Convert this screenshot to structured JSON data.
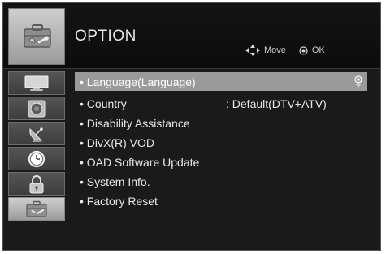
{
  "header": {
    "title": "OPTION",
    "icon": "toolbox-icon",
    "hints": {
      "move_label": "Move",
      "ok_label": "OK"
    }
  },
  "sidebar": {
    "items": [
      {
        "name": "picture",
        "icon": "monitor-icon",
        "active": false
      },
      {
        "name": "sound",
        "icon": "speaker-icon",
        "active": false
      },
      {
        "name": "setup",
        "icon": "satellite-dish-icon",
        "active": false
      },
      {
        "name": "time",
        "icon": "clock-icon",
        "active": false
      },
      {
        "name": "lock",
        "icon": "padlock-icon",
        "active": false
      },
      {
        "name": "option",
        "icon": "toolbox-icon",
        "active": true
      }
    ]
  },
  "menu": {
    "items": [
      {
        "label": "• Language(Language)",
        "value": "",
        "selected": true
      },
      {
        "label": "• Country",
        "value": ": Default(DTV+ATV)",
        "selected": false
      },
      {
        "label": "• Disability Assistance",
        "value": "",
        "selected": false
      },
      {
        "label": "• DivX(R) VOD",
        "value": "",
        "selected": false
      },
      {
        "label": "• OAD Software Update",
        "value": "",
        "selected": false
      },
      {
        "label": "• System Info.",
        "value": "",
        "selected": false
      },
      {
        "label": "• Factory Reset",
        "value": "",
        "selected": false
      }
    ]
  },
  "colors": {
    "background": "#1a1a1a",
    "selected_row": "#9a9a9a",
    "active_tab": "#bdbdbd",
    "text": "#e8e8e8"
  }
}
